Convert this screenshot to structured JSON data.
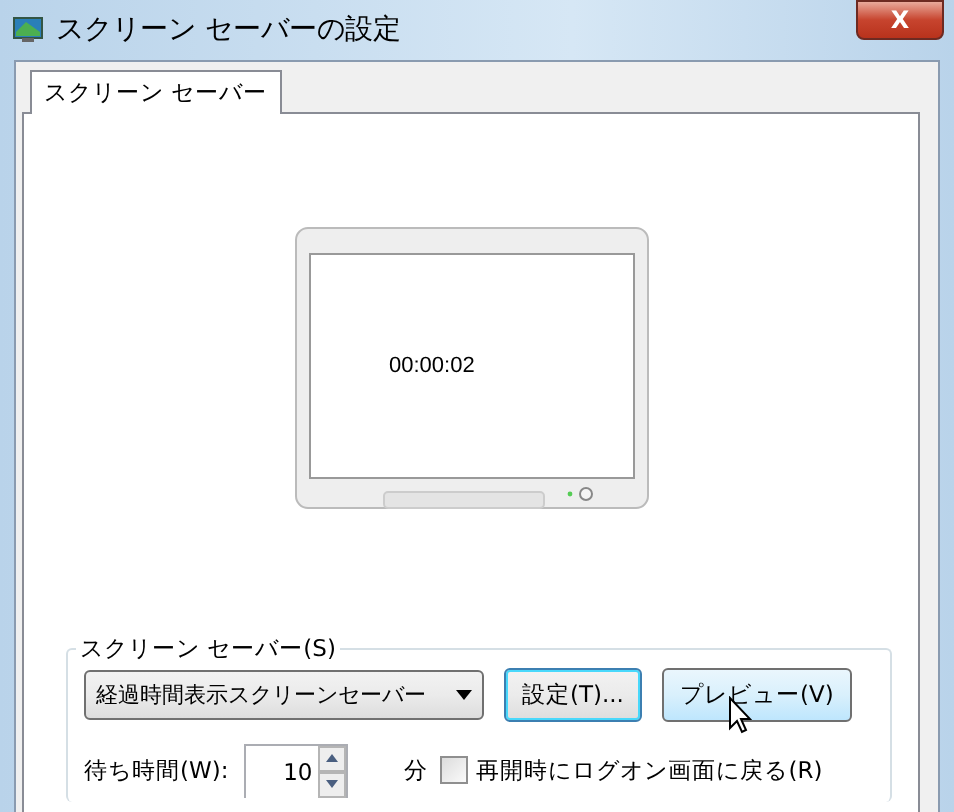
{
  "window": {
    "title": "スクリーン セーバーの設定",
    "close": "X"
  },
  "tabs": [
    {
      "label": "スクリーン セーバー",
      "selected": true
    }
  ],
  "preview": {
    "clock": "00:00:02"
  },
  "group": {
    "label": "スクリーン セーバー(S)",
    "dropdown": {
      "value": "経過時間表示スクリーンセーバー"
    },
    "buttons": [
      {
        "label": "設定(T)...",
        "focused": true,
        "hovered": false
      },
      {
        "label": "プレビュー(V)",
        "focused": false,
        "hovered": true
      }
    ],
    "wait_label": "待ち時間(W):",
    "wait_value": "10",
    "unit": "分",
    "checkbox": {
      "label": "再開時にログオン画面に戻る(R)",
      "checked": false
    }
  }
}
